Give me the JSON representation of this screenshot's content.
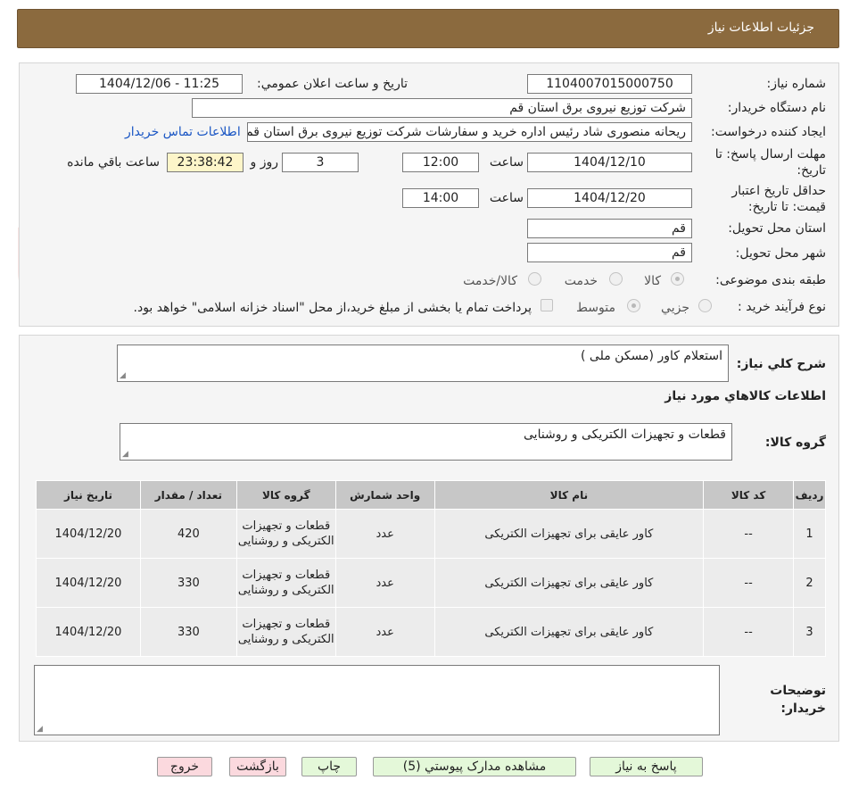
{
  "header": {
    "title": "جزئیات اطلاعات نیاز"
  },
  "watermark": {
    "text": "AriaTender.neT"
  },
  "form": {
    "need_number_label": "شماره نیاز:",
    "need_number": "1104007015000750",
    "announce_label": "تاریخ و ساعت اعلان عمومي:",
    "announce_value": "1404/12/06 - 11:25",
    "buyer_label": "نام دستگاه خریدار:",
    "buyer_value": "شرکت توزیع نیروی برق استان قم",
    "creator_label": "ایجاد کننده درخواست:",
    "creator_value": "ریحانه منصوری شاد رئیس اداره خرید و سفارشات شرکت توزیع نیروی برق استان قم",
    "contact_link": "اطلاعات تماس خریدار",
    "deadline_label_1": "مهلت ارسال پاسخ: تا",
    "deadline_label_2": "تاریخ:",
    "deadline_date": "1404/12/10",
    "time_label": "ساعت",
    "deadline_time": "12:00",
    "days_value": "3",
    "days_label": "روز و",
    "remaining_time": "23:38:42",
    "remaining_label": "ساعت باقي مانده",
    "validity_label_1": "حداقل تاریخ اعتبار",
    "validity_label_2": "قیمت: تا تاریخ:",
    "validity_date": "1404/12/20",
    "validity_time": "14:00",
    "province_label": "استان محل تحویل:",
    "province_value": "قم",
    "city_label": "شهر محل تحویل:",
    "city_value": "قم",
    "category_label": "طبقه بندی موضوعی:",
    "category_options": [
      "کالا",
      "خدمت",
      "کالا/خدمت"
    ],
    "category_selected": "کالا",
    "process_label": "نوع فرآیند خرید :",
    "process_options": [
      "جزيي",
      "متوسط"
    ],
    "process_selected": "متوسط",
    "payment_note": "پرداخت تمام یا بخشی از مبلغ خرید،از محل \"اسناد خزانه اسلامی\" خواهد بود."
  },
  "summary": {
    "desc_label": "شرح کلي نياز:",
    "desc_value": "استعلام کاور (مسکن ملی )",
    "goods_info_title": "اطلاعات کالاهاي مورد نياز",
    "group_label": "گروه کالا:",
    "group_value": "قطعات و تجهیزات الکتریکی و روشنایی"
  },
  "table": {
    "headers": [
      "رديف",
      "کد کالا",
      "نام کالا",
      "واحد شمارش",
      "گروه کالا",
      "تعداد / مقدار",
      "تاریخ نیاز"
    ],
    "rows": [
      {
        "row": "1",
        "code": "--",
        "name": "کاور عایقی برای تجهیزات الکتریکی",
        "unit": "عدد",
        "group": "قطعات و تجهیزات الکتریکی و روشنایی",
        "qty": "420",
        "date": "1404/12/20"
      },
      {
        "row": "2",
        "code": "--",
        "name": "کاور عایقی برای تجهیزات الکتریکی",
        "unit": "عدد",
        "group": "قطعات و تجهیزات الکتریکی و روشنایی",
        "qty": "330",
        "date": "1404/12/20"
      },
      {
        "row": "3",
        "code": "--",
        "name": "کاور عایقی برای تجهیزات الکتریکی",
        "unit": "عدد",
        "group": "قطعات و تجهیزات الکتریکی و روشنایی",
        "qty": "330",
        "date": "1404/12/20"
      }
    ]
  },
  "notes": {
    "label_1": "توضیحات",
    "label_2": "خریدار:",
    "value": ""
  },
  "buttons": {
    "reply": "پاسخ به نياز",
    "attachments": "مشاهده مدارک پیوستي (5)",
    "print": "چاپ",
    "back": "بازگشت",
    "exit": "خروج"
  }
}
